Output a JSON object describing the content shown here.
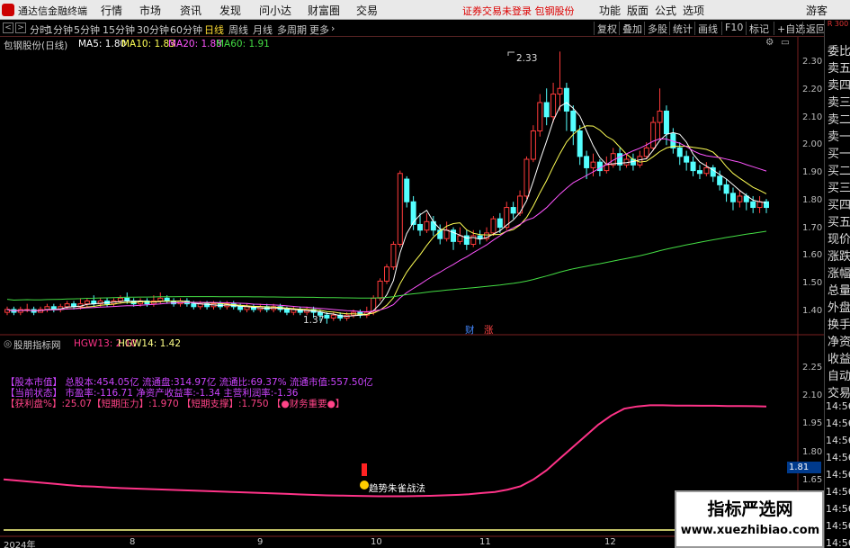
{
  "menubar": {
    "app_title": "通达信金融终端",
    "items": [
      "行情",
      "市场",
      "资讯",
      "发现",
      "问小达",
      "财富圈",
      "交易"
    ],
    "login_warning": "证券交易未登录  包钢股份",
    "right_items": [
      "功能",
      "版面",
      "公式",
      "选项"
    ],
    "guest": "游客"
  },
  "toolbar": {
    "nav_prev": "<",
    "nav_next": ">",
    "periods": [
      "分时",
      "1分钟",
      "5分钟",
      "15分钟",
      "30分钟",
      "60分钟",
      "日线",
      "周线",
      "月线",
      "多周期",
      "更多"
    ],
    "active_period": "日线",
    "more_arrow": "›",
    "buttons": [
      "复权",
      "叠加",
      "多股",
      "统计",
      "画线",
      "F10",
      "标记",
      "+自选",
      "返回"
    ]
  },
  "main_chart": {
    "stock_label": "包钢股份(日线)",
    "ma_labels": [
      {
        "text": "MA5: 1.80",
        "color": "#ffffff"
      },
      {
        "text": "MA10: 1.83",
        "color": "#ffff55"
      },
      {
        "text": "MA20: 1.88",
        "color": "#ff55ff"
      },
      {
        "text": "MA60: 1.91",
        "color": "#44dd44"
      }
    ],
    "high_label": "2.33",
    "low_label": "1.37",
    "markers": [
      {
        "text": "财",
        "color": "#4488ff"
      },
      {
        "text": "涨",
        "color": "#ff4444"
      }
    ],
    "y_ticks": [
      "2.30",
      "2.20",
      "2.10",
      "2.00",
      "1.90",
      "1.80",
      "1.70",
      "1.60",
      "1.50",
      "1.40"
    ]
  },
  "indicator": {
    "name": "股朋指标网",
    "hgw13": "HGW13: 2.10",
    "hgw14": "HGW14: 1.42",
    "info_lines": [
      {
        "text": "【股本市值】  总股本:454.05亿 流通盘:314.97亿 流通比:69.37% 流通市值:557.50亿",
        "color": "#cc44ff"
      },
      {
        "text": "【当前状态】  市盈率:-116.71 净资产收益率:-1.34 主营利润率:-1.36",
        "color": "#cc44ff"
      },
      {
        "text": "【获利盘%】:25.07【短期压力】:1.970 【短期支撑】:1.750 【●财务重要●】",
        "color": "#ff4488"
      }
    ],
    "signal_label": "趋势朱雀战法",
    "current_value": "1.81",
    "y_ticks": [
      "2.25",
      "2.10",
      "1.95",
      "1.80",
      "1.65"
    ]
  },
  "x_axis": {
    "labels": [
      "2024年",
      "8",
      "9",
      "10",
      "11",
      "12"
    ]
  },
  "sidebar": {
    "top": "R 300",
    "items": [
      "委比",
      "卖五",
      "卖四",
      "卖三",
      "卖二",
      "卖一",
      "买一",
      "买二",
      "买三",
      "买四",
      "买五",
      "现价",
      "涨跌",
      "涨幅",
      "总量",
      "外盘",
      "换手",
      "净资",
      "收益",
      "自动",
      "交易",
      "14:56",
      "14:56",
      "14:56",
      "14:56",
      "14:56",
      "14:56",
      "14:56",
      "14:56",
      "14:56"
    ]
  },
  "watermark": {
    "title": "指标严选网",
    "url": "www.xuezhibiao.com"
  },
  "chart_data": [
    {
      "type": "candlestick",
      "title": "包钢股份(日线)",
      "ylim": [
        1.35,
        2.35
      ],
      "candles": [
        [
          1.41,
          1.42,
          1.4,
          1.43
        ],
        [
          1.42,
          1.41,
          1.4,
          1.43
        ],
        [
          1.41,
          1.42,
          1.4,
          1.43
        ],
        [
          1.42,
          1.42,
          1.41,
          1.44
        ],
        [
          1.42,
          1.41,
          1.4,
          1.43
        ],
        [
          1.41,
          1.42,
          1.41,
          1.43
        ],
        [
          1.42,
          1.43,
          1.41,
          1.44
        ],
        [
          1.43,
          1.42,
          1.41,
          1.44
        ],
        [
          1.42,
          1.43,
          1.41,
          1.44
        ],
        [
          1.43,
          1.44,
          1.42,
          1.45
        ],
        [
          1.44,
          1.43,
          1.42,
          1.45
        ],
        [
          1.43,
          1.44,
          1.42,
          1.46
        ],
        [
          1.44,
          1.45,
          1.43,
          1.46
        ],
        [
          1.45,
          1.44,
          1.43,
          1.47
        ],
        [
          1.44,
          1.45,
          1.43,
          1.46
        ],
        [
          1.45,
          1.44,
          1.43,
          1.46
        ],
        [
          1.44,
          1.45,
          1.43,
          1.46
        ],
        [
          1.45,
          1.46,
          1.44,
          1.47
        ],
        [
          1.46,
          1.45,
          1.44,
          1.48
        ],
        [
          1.45,
          1.44,
          1.43,
          1.46
        ],
        [
          1.44,
          1.45,
          1.43,
          1.46
        ],
        [
          1.45,
          1.44,
          1.43,
          1.46
        ],
        [
          1.44,
          1.45,
          1.43,
          1.47
        ],
        [
          1.45,
          1.46,
          1.44,
          1.48
        ],
        [
          1.46,
          1.45,
          1.44,
          1.47
        ],
        [
          1.45,
          1.44,
          1.43,
          1.46
        ],
        [
          1.44,
          1.45,
          1.43,
          1.46
        ],
        [
          1.45,
          1.44,
          1.43,
          1.46
        ],
        [
          1.44,
          1.43,
          1.42,
          1.45
        ],
        [
          1.43,
          1.44,
          1.42,
          1.45
        ],
        [
          1.44,
          1.43,
          1.42,
          1.45
        ],
        [
          1.43,
          1.44,
          1.42,
          1.45
        ],
        [
          1.44,
          1.43,
          1.42,
          1.45
        ],
        [
          1.43,
          1.44,
          1.42,
          1.45
        ],
        [
          1.44,
          1.43,
          1.42,
          1.45
        ],
        [
          1.43,
          1.42,
          1.41,
          1.44
        ],
        [
          1.42,
          1.43,
          1.41,
          1.44
        ],
        [
          1.43,
          1.42,
          1.41,
          1.44
        ],
        [
          1.42,
          1.43,
          1.41,
          1.44
        ],
        [
          1.43,
          1.42,
          1.41,
          1.44
        ],
        [
          1.42,
          1.43,
          1.41,
          1.44
        ],
        [
          1.43,
          1.42,
          1.41,
          1.44
        ],
        [
          1.42,
          1.41,
          1.4,
          1.43
        ],
        [
          1.41,
          1.42,
          1.4,
          1.43
        ],
        [
          1.42,
          1.41,
          1.4,
          1.43
        ],
        [
          1.41,
          1.42,
          1.4,
          1.43
        ],
        [
          1.42,
          1.41,
          1.39,
          1.43
        ],
        [
          1.41,
          1.4,
          1.38,
          1.42
        ],
        [
          1.4,
          1.39,
          1.37,
          1.41
        ],
        [
          1.39,
          1.4,
          1.38,
          1.41
        ],
        [
          1.4,
          1.39,
          1.38,
          1.41
        ],
        [
          1.39,
          1.4,
          1.38,
          1.41
        ],
        [
          1.4,
          1.41,
          1.39,
          1.42
        ],
        [
          1.41,
          1.4,
          1.39,
          1.42
        ],
        [
          1.4,
          1.41,
          1.39,
          1.43
        ],
        [
          1.41,
          1.46,
          1.4,
          1.47
        ],
        [
          1.46,
          1.52,
          1.45,
          1.53
        ],
        [
          1.52,
          1.57,
          1.51,
          1.58
        ],
        [
          1.57,
          1.65,
          1.56,
          1.66
        ],
        [
          1.65,
          1.9,
          1.64,
          1.91
        ],
        [
          1.88,
          1.8,
          1.78,
          1.89
        ],
        [
          1.8,
          1.72,
          1.7,
          1.82
        ],
        [
          1.72,
          1.7,
          1.68,
          1.76
        ],
        [
          1.7,
          1.73,
          1.69,
          1.76
        ],
        [
          1.73,
          1.7,
          1.68,
          1.75
        ],
        [
          1.7,
          1.67,
          1.65,
          1.72
        ],
        [
          1.67,
          1.7,
          1.66,
          1.73
        ],
        [
          1.7,
          1.66,
          1.63,
          1.71
        ],
        [
          1.66,
          1.68,
          1.65,
          1.71
        ],
        [
          1.68,
          1.65,
          1.63,
          1.7
        ],
        [
          1.65,
          1.68,
          1.64,
          1.7
        ],
        [
          1.68,
          1.67,
          1.65,
          1.7
        ],
        [
          1.67,
          1.69,
          1.66,
          1.71
        ],
        [
          1.69,
          1.74,
          1.68,
          1.75
        ],
        [
          1.74,
          1.71,
          1.69,
          1.76
        ],
        [
          1.71,
          1.78,
          1.7,
          1.8
        ],
        [
          1.78,
          1.76,
          1.74,
          1.8
        ],
        [
          1.76,
          1.82,
          1.75,
          1.84
        ],
        [
          1.82,
          1.95,
          1.81,
          1.96
        ],
        [
          1.95,
          2.05,
          1.94,
          2.07
        ],
        [
          2.05,
          2.15,
          2.03,
          2.18
        ],
        [
          2.15,
          2.1,
          2.07,
          2.2
        ],
        [
          2.1,
          2.18,
          2.08,
          2.22
        ],
        [
          2.18,
          2.2,
          2.12,
          2.33
        ],
        [
          2.2,
          2.12,
          2.05,
          2.22
        ],
        [
          2.12,
          2.05,
          2.0,
          2.14
        ],
        [
          2.05,
          1.96,
          1.93,
          2.07
        ],
        [
          1.96,
          1.92,
          1.88,
          1.98
        ],
        [
          1.92,
          1.94,
          1.89,
          1.97
        ],
        [
          1.94,
          1.91,
          1.89,
          1.95
        ],
        [
          1.91,
          1.93,
          1.9,
          1.96
        ],
        [
          1.93,
          1.97,
          1.92,
          1.99
        ],
        [
          1.97,
          1.93,
          1.91,
          1.99
        ],
        [
          1.93,
          1.95,
          1.92,
          1.97
        ],
        [
          1.95,
          1.93,
          1.91,
          1.97
        ],
        [
          1.93,
          1.96,
          1.92,
          1.98
        ],
        [
          1.96,
          1.99,
          1.95,
          2.01
        ],
        [
          1.99,
          2.08,
          1.98,
          2.1
        ],
        [
          2.08,
          2.12,
          2.02,
          2.2
        ],
        [
          2.12,
          2.04,
          2.0,
          2.14
        ],
        [
          2.04,
          1.99,
          1.97,
          2.06
        ],
        [
          1.99,
          1.96,
          1.93,
          2.01
        ],
        [
          1.96,
          1.94,
          1.91,
          1.98
        ],
        [
          1.94,
          1.91,
          1.89,
          1.96
        ],
        [
          1.91,
          1.9,
          1.88,
          1.93
        ],
        [
          1.9,
          1.92,
          1.89,
          1.94
        ],
        [
          1.92,
          1.89,
          1.87,
          1.93
        ],
        [
          1.89,
          1.86,
          1.84,
          1.91
        ],
        [
          1.86,
          1.83,
          1.8,
          1.88
        ],
        [
          1.83,
          1.8,
          1.77,
          1.85
        ],
        [
          1.8,
          1.82,
          1.78,
          1.84
        ],
        [
          1.82,
          1.8,
          1.77,
          1.83
        ],
        [
          1.8,
          1.78,
          1.76,
          1.82
        ],
        [
          1.78,
          1.8,
          1.76,
          1.82
        ],
        [
          1.8,
          1.78,
          1.76,
          1.81
        ]
      ],
      "ma_series": [
        {
          "name": "MA5",
          "color": "#ffffff"
        },
        {
          "name": "MA10",
          "color": "#ffff55"
        },
        {
          "name": "MA20",
          "color": "#ff55ff"
        },
        {
          "name": "MA60",
          "color": "#44dd44"
        }
      ]
    },
    {
      "type": "line",
      "title": "股朋指标网",
      "ylim": [
        1.55,
        2.3
      ],
      "series": [
        {
          "name": "HGW13",
          "color": "#ff3388",
          "values": [
            1.78,
            1.775,
            1.77,
            1.765,
            1.76,
            1.755,
            1.75,
            1.748,
            1.745,
            1.742,
            1.74,
            1.738,
            1.736,
            1.734,
            1.732,
            1.73,
            1.728,
            1.726,
            1.724,
            1.722,
            1.72,
            1.718,
            1.716,
            1.714,
            1.712,
            1.71,
            1.709,
            1.708,
            1.707,
            1.706,
            1.706,
            1.706,
            1.707,
            1.708,
            1.71,
            1.712,
            1.715,
            1.72,
            1.725,
            1.735,
            1.75,
            1.78,
            1.82,
            1.87,
            1.92,
            1.97,
            2.02,
            2.06,
            2.09,
            2.1,
            2.105,
            2.105,
            2.104,
            2.104,
            2.103,
            2.103,
            2.102,
            2.102,
            2.101,
            2.1
          ]
        },
        {
          "name": "HGW14",
          "color": "#ffff88",
          "values": [
            1.42,
            1.421,
            1.421,
            1.422,
            1.422,
            1.423,
            1.423,
            1.423,
            1.424,
            1.424,
            1.424,
            1.425,
            1.425,
            1.425,
            1.426,
            1.426,
            1.426,
            1.427,
            1.427,
            1.427,
            1.428,
            1.428,
            1.428,
            1.429,
            1.429,
            1.43,
            1.43,
            1.43,
            1.431,
            1.431,
            1.432,
            1.432,
            1.433,
            1.433,
            1.434,
            1.434,
            1.435,
            1.435,
            1.436,
            1.436,
            1.437,
            1.437,
            1.438,
            1.438,
            1.438,
            1.439,
            1.439,
            1.44,
            1.44,
            1.44,
            1.44,
            1.44,
            1.441,
            1.441,
            1.441,
            1.421,
            1.421,
            1.421,
            1.421,
            1.42
          ]
        }
      ]
    }
  ]
}
